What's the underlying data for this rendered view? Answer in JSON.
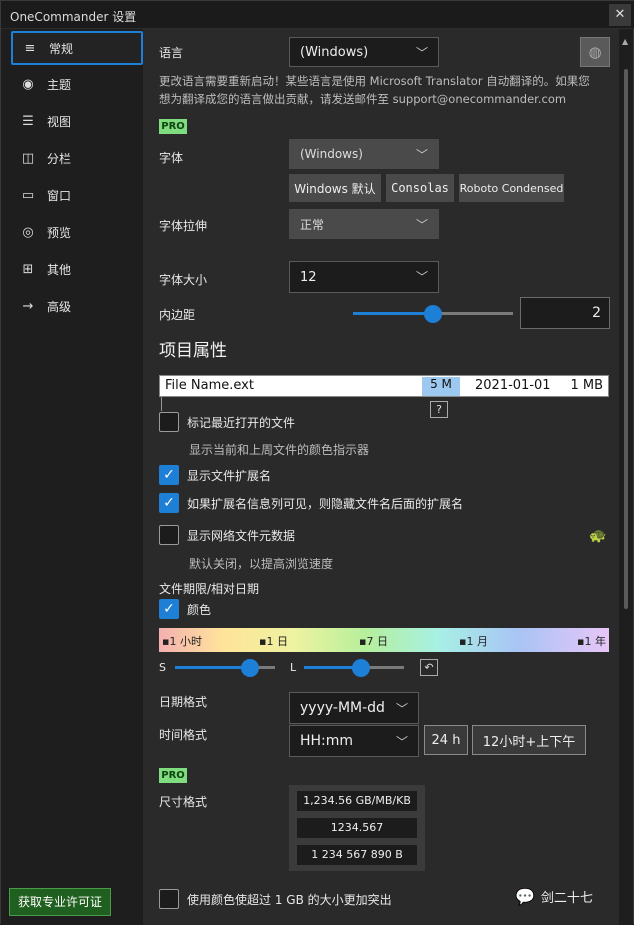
{
  "window": {
    "title": "OneCommander 设置",
    "close": "✕"
  },
  "sidebar": {
    "items": [
      {
        "label": "常规",
        "icon": "≡"
      },
      {
        "label": "主题",
        "icon": "◉"
      },
      {
        "label": "视图",
        "icon": "☰"
      },
      {
        "label": "分栏",
        "icon": "◫"
      },
      {
        "label": "窗口",
        "icon": "▭"
      },
      {
        "label": "预览",
        "icon": "◎"
      },
      {
        "label": "其他",
        "icon": "⊞"
      },
      {
        "label": "高级",
        "icon": "→"
      }
    ],
    "license_button": "获取专业许可证"
  },
  "language": {
    "label": "语言",
    "value": "(Windows)",
    "note_line1": "更改语言需要重新启动！某些语言是使用 Microsoft Translator 自动翻译的。如果您",
    "note_line2": "想为翻译成您的语言做出贡献，请发送邮件至 support@onecommander.com"
  },
  "pro_badge": "PRO",
  "font": {
    "label": "字体",
    "value": "(Windows)",
    "buttons": [
      "Windows 默认",
      "Consolas",
      "Roboto Condensed"
    ]
  },
  "font_stretch": {
    "label": "字体拉伸",
    "value": "正常"
  },
  "font_size": {
    "label": "字体大小",
    "value": "12"
  },
  "padding": {
    "label": "内边距",
    "value": "2",
    "level": 0.6
  },
  "item_props": {
    "heading": "项目属性",
    "preview_name": "File Name.ext",
    "preview_tag": "5 M",
    "preview_date": "2021-01-01",
    "preview_size": "1 MB",
    "help": "?"
  },
  "checks": {
    "recent": {
      "label": "标记最近打开的文件",
      "sub": "显示当前和上周文件的颜色指示器",
      "checked": false
    },
    "show_ext": {
      "label": "显示文件扩展名",
      "checked": true
    },
    "hide_ext": {
      "label": "如果扩展名信息列可见，则隐藏文件名后面的扩展名",
      "checked": true
    },
    "network": {
      "label": "显示网络文件元数据",
      "sub": "默认关闭，以提高浏览速度",
      "checked": false
    }
  },
  "file_age": {
    "label": "文件期限/相对日期",
    "color_label": "颜色",
    "color_checked": true,
    "marks": [
      "1 小时",
      "1 日",
      "7 日",
      "1 月",
      "1 年"
    ],
    "s_label": "S",
    "l_label": "L"
  },
  "date_format": {
    "label": "日期格式",
    "value": "yyyy-MM-dd"
  },
  "time_format": {
    "label": "时间格式",
    "value": "HH:mm",
    "btn24": "24 h",
    "btn12": "12小时+上下午"
  },
  "size_format": {
    "label": "尺寸格式",
    "options": [
      "1,234.56 GB/MB/KB",
      "1234.567",
      "1 234 567 890 B"
    ]
  },
  "large_size": {
    "label": "使用颜色使超过 1 GB 的大小更加突出",
    "checked": false
  },
  "watermark": {
    "text": "剑二十七"
  }
}
